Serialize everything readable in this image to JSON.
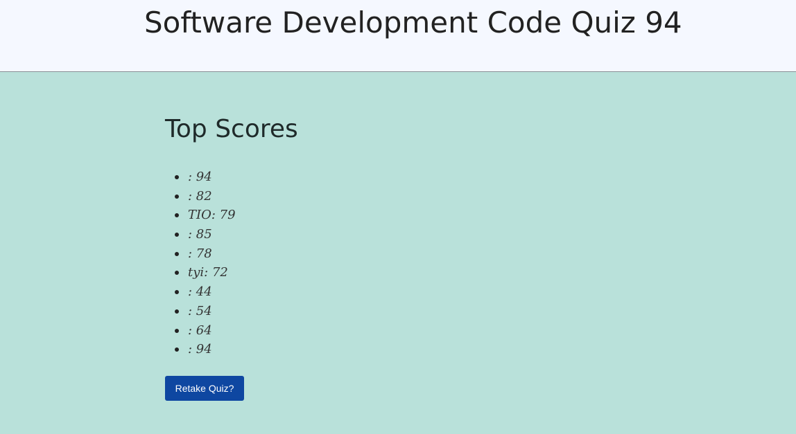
{
  "header": {
    "title": "Software Development Code Quiz 94"
  },
  "scores": {
    "title": "Top Scores",
    "items": [
      {
        "text": ": 94"
      },
      {
        "text": ": 82"
      },
      {
        "text": "TIO: 79"
      },
      {
        "text": ": 85"
      },
      {
        "text": ": 78"
      },
      {
        "text": "tyi: 72"
      },
      {
        "text": ": 44"
      },
      {
        "text": ": 54"
      },
      {
        "text": ": 64"
      },
      {
        "text": ": 94"
      }
    ]
  },
  "actions": {
    "retake_label": "Retake Quiz?"
  },
  "colors": {
    "header_bg": "#f5f8ff",
    "page_bg": "#b9e1da",
    "button_bg": "#0e47a1",
    "button_text": "#ffffff"
  }
}
